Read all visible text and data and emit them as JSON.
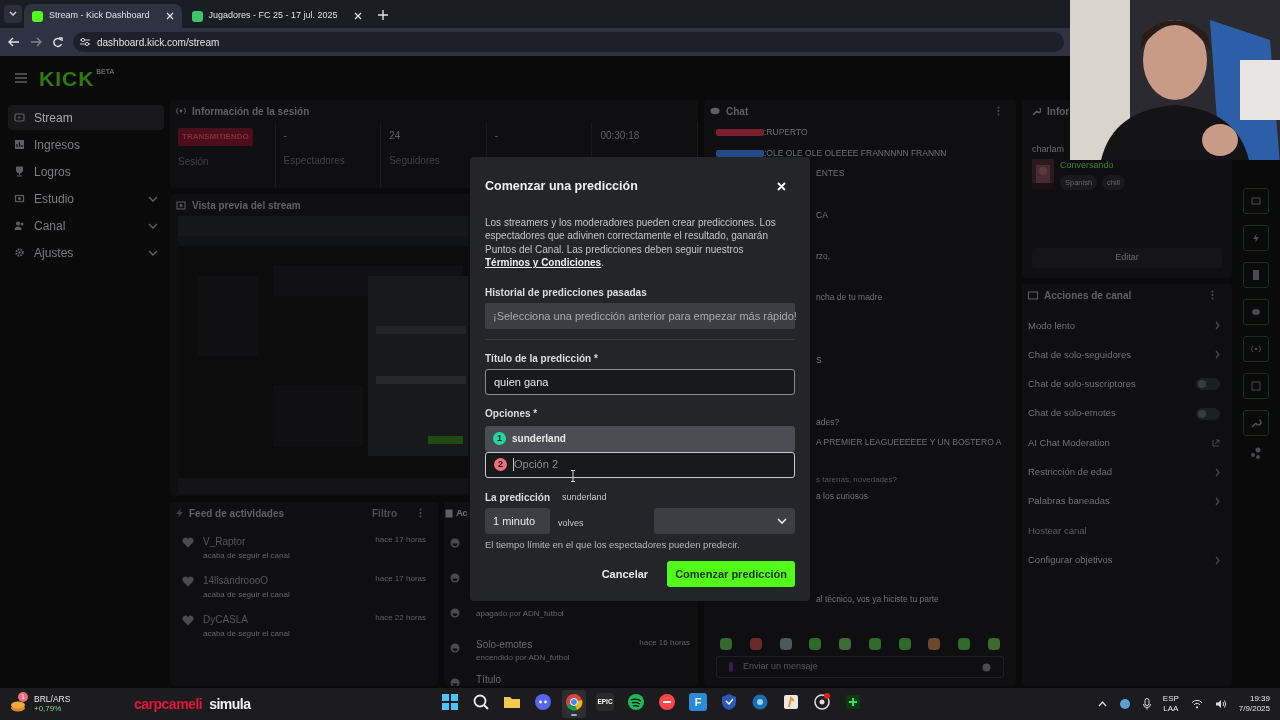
{
  "browser": {
    "tabs": [
      {
        "title": "Stream - Kick Dashboard",
        "selected": true
      },
      {
        "title": "Jugadores - FC 25 - 17 jul. 2025",
        "selected": false
      }
    ],
    "url": "dashboard.kick.com/stream"
  },
  "header": {
    "logo": "KICK",
    "logo_tag": "BETA"
  },
  "sidebar": {
    "items": [
      {
        "label": "Stream",
        "selected": true,
        "expandable": false
      },
      {
        "label": "Ingresos",
        "selected": false,
        "expandable": false
      },
      {
        "label": "Logros",
        "selected": false,
        "expandable": false
      },
      {
        "label": "Estudio",
        "selected": false,
        "expandable": true
      },
      {
        "label": "Canal",
        "selected": false,
        "expandable": true
      },
      {
        "label": "Ajustes",
        "selected": false,
        "expandable": true
      }
    ]
  },
  "session": {
    "title": "Información de la sesión",
    "stats": [
      {
        "kind": "badge",
        "value": "TRANSMITIENDO",
        "label": "Sesión"
      },
      {
        "kind": "stat",
        "value": "-",
        "label": "Espectadores"
      },
      {
        "kind": "stat",
        "value": "24",
        "label": "Seguidores"
      },
      {
        "kind": "stat",
        "value": "-"
      },
      {
        "kind": "stat",
        "value": "00:30:18"
      }
    ]
  },
  "preview": {
    "title": "Vista previa del stream"
  },
  "activity_feed": {
    "title": "Feed de actividades",
    "filter": "Filtro",
    "items": [
      {
        "user": "V_Raptor",
        "action": "acaba de seguir el canal",
        "time": "hace 17 horas"
      },
      {
        "user": "14lisandroooO",
        "action": "acaba de seguir el canal",
        "time": "hace 17 horas"
      },
      {
        "user": "DyCASLA",
        "action": "acaba de seguir el canal",
        "time": "hace 22 horas"
      }
    ]
  },
  "mod_log": {
    "title": "Ac",
    "items": [
      {
        "kind": "covered"
      },
      {
        "kind": "covered"
      },
      {
        "kind": "entry",
        "detail": "apagado por ADN_futbol"
      },
      {
        "kind": "entry",
        "title": "Solo-emotes",
        "detail": "encendido por ADN_futbol",
        "time": "hace 16 horas"
      },
      {
        "kind": "entry",
        "title": "Título"
      }
    ]
  },
  "chat": {
    "title": "Chat",
    "messages": [
      {
        "kind": "full",
        "text": ":RUPERTO"
      },
      {
        "kind": "full",
        "text": ":OLE OLE OLE OLEEEE FRANNNNN FRANNN"
      },
      {
        "kind": "cut",
        "text": "ENTES"
      },
      {
        "kind": "covered"
      },
      {
        "kind": "cut",
        "text": "CA"
      },
      {
        "kind": "covered"
      },
      {
        "kind": "cut",
        "text": "rzo."
      },
      {
        "kind": "covered"
      },
      {
        "kind": "cut",
        "text": "ncha de tu madre"
      },
      {
        "kind": "covered"
      },
      {
        "kind": "covered"
      },
      {
        "kind": "cut",
        "text": "S"
      },
      {
        "kind": "covered"
      },
      {
        "kind": "covered"
      },
      {
        "kind": "cut",
        "text": "ades?"
      },
      {
        "kind": "cut",
        "text": "A PREMIER LEAGUEEEEEE Y UN BOSTERO A"
      },
      {
        "kind": "covered"
      },
      {
        "kind": "reply",
        "text": "s tarenas, novedades?"
      },
      {
        "kind": "cut",
        "text": "a los curiosos"
      },
      {
        "kind": "covered"
      },
      {
        "kind": "covered"
      },
      {
        "kind": "covered"
      },
      {
        "kind": "covered"
      },
      {
        "kind": "cut",
        "text": "al técnico, vos ya hiciste tu parte"
      }
    ],
    "input_placeholder": "Enviar un mensaje"
  },
  "stream_info": {
    "title": "Infor",
    "user": "charlam",
    "category": "Conversando",
    "tags": [
      "Spanish",
      "chill"
    ],
    "edit": "Editar"
  },
  "channel_actions": {
    "title": "Acciones de canal",
    "items": [
      {
        "kind": "link",
        "label": "Modo lento"
      },
      {
        "kind": "link",
        "label": "Chat de solo-seguidores"
      },
      {
        "kind": "toggle",
        "label": "Chat de solo-suscriptores",
        "on": false
      },
      {
        "kind": "toggle",
        "label": "Chat de solo-emotes",
        "on": false
      },
      {
        "kind": "external",
        "label": "AI Chat Moderation"
      },
      {
        "kind": "link",
        "label": "Restricción de edad"
      },
      {
        "kind": "link",
        "label": "Palabras baneadas"
      },
      {
        "kind": "disabled",
        "label": "Hostear canal"
      },
      {
        "kind": "link",
        "label": "Configurar objetivos"
      }
    ]
  },
  "modal": {
    "title": "Comenzar una predicción",
    "intro": "Los streamers y los moderadores pueden crear predicciones. Los espectadores que adivinen correctamente el resultado, ganarán Puntos del Canal. Las predicciones deben seguir nuestros",
    "terms": "Términos y Condiciones",
    "terms_end": ".",
    "history_label": "Historial de predicciones pasadas",
    "history_placeholder": "¡Selecciona una predicción anterior para empezar más rápido!",
    "title_label": "Título de la predicción *",
    "title_value": "quien gana",
    "options_label": "Opciones *",
    "options": [
      {
        "number": "1",
        "value": "sunderland",
        "color": "#1ed9a0",
        "focused": false
      },
      {
        "number": "2",
        "placeholder": "Opción 2",
        "color": "#f0707a",
        "focused": true
      }
    ],
    "duration_label": "La predicción",
    "ghost_1": "sunderland",
    "duration": "1 minuto",
    "ghost_2": "volves",
    "duration_help": "El tiempo límite en el que los espectadores pueden predecir.",
    "cancel": "Cancelar",
    "submit": "Comenzar predicción"
  },
  "taskbar": {
    "widget_badge": "1",
    "pair": "BRL/ARS",
    "change": "+0,79%",
    "ticker_red": "carpcameli",
    "ticker_white": "simula",
    "apps": [
      {
        "kind": "windows",
        "active": false
      },
      {
        "kind": "search",
        "active": false
      },
      {
        "kind": "folder",
        "active": false
      },
      {
        "kind": "discord",
        "active": false
      },
      {
        "kind": "chrome",
        "active": true
      },
      {
        "kind": "label",
        "label": "EPIC",
        "active": false
      },
      {
        "kind": "spotify",
        "active": false
      },
      {
        "kind": "ea",
        "active": false
      },
      {
        "kind": "label",
        "label": "F",
        "active": false
      },
      {
        "kind": "shield",
        "active": false
      },
      {
        "kind": "blue",
        "active": false
      },
      {
        "kind": "cs",
        "active": false
      },
      {
        "kind": "steam",
        "active": false
      },
      {
        "kind": "fc",
        "active": false
      }
    ],
    "lang": "ESP",
    "layout": "LAA",
    "time": "19:39",
    "date": "7/9/2025"
  }
}
